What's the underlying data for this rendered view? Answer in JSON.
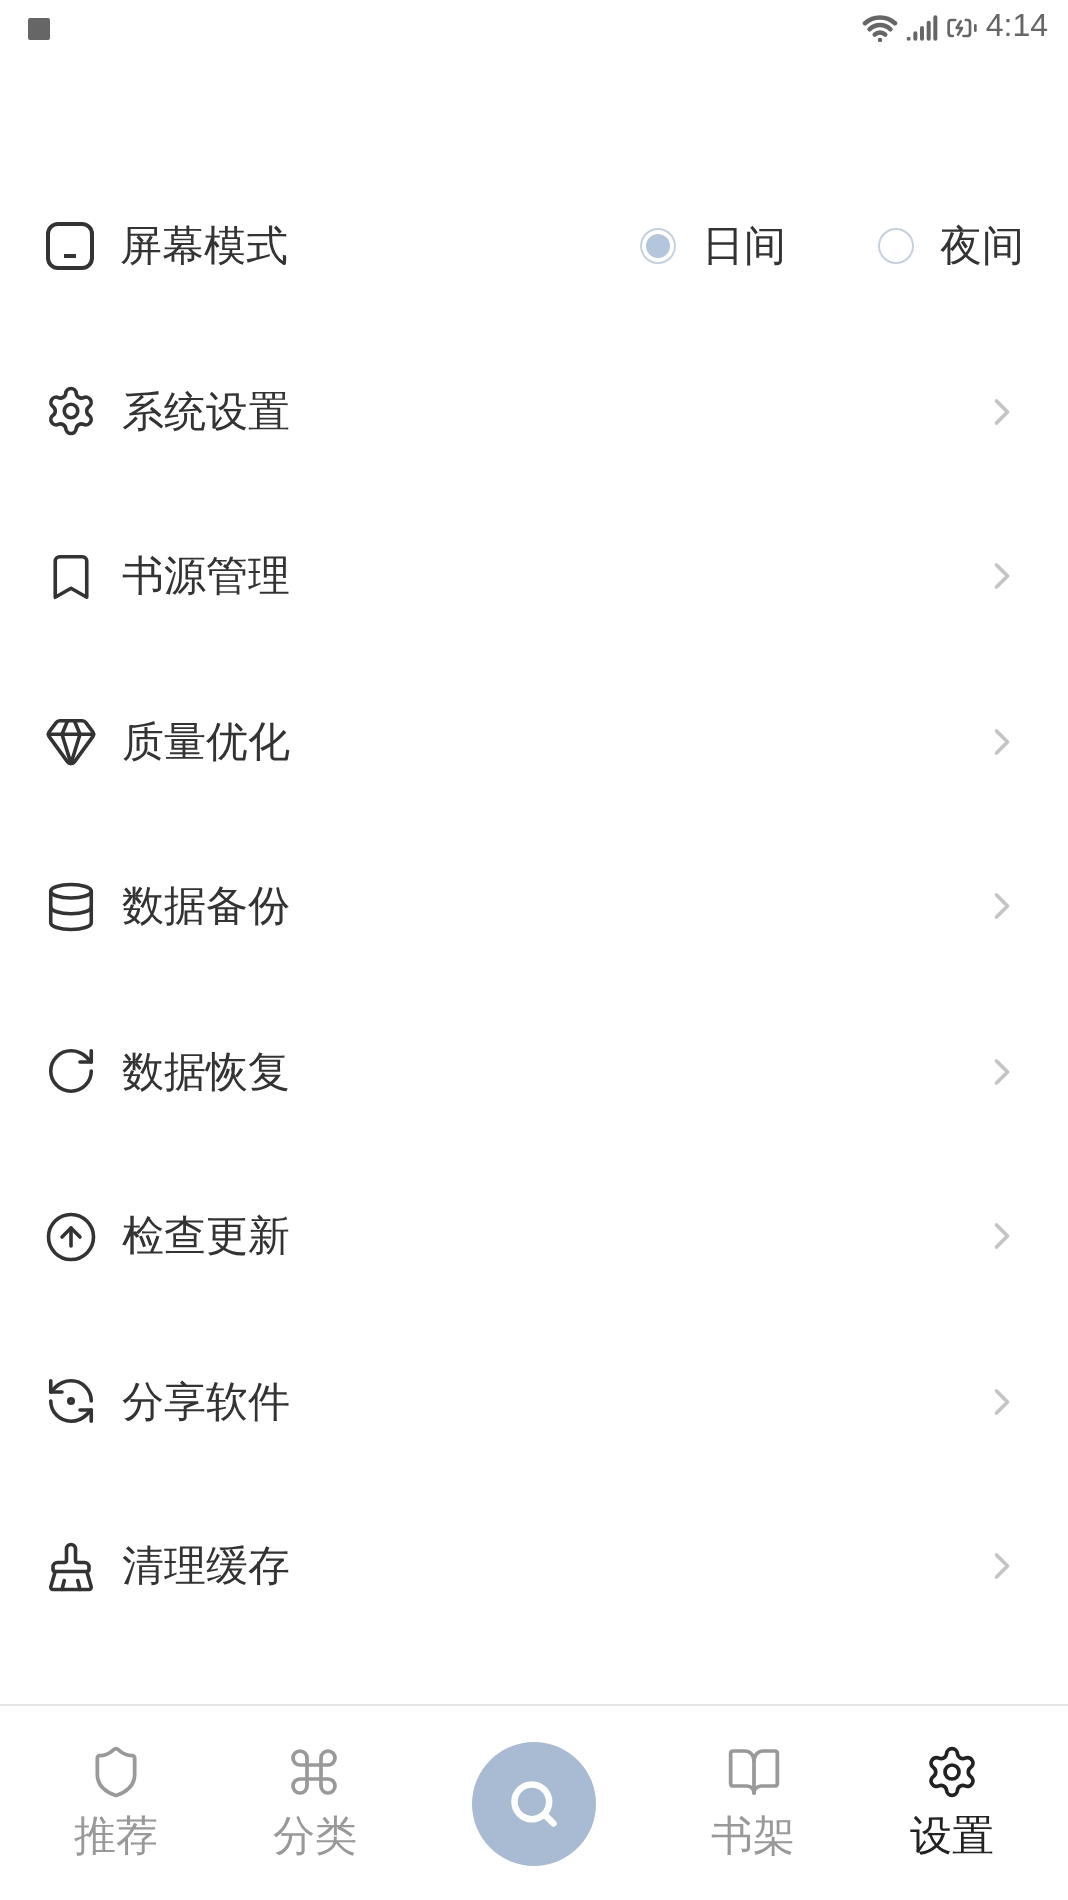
{
  "status_bar": {
    "time": "4:14"
  },
  "rows": [
    {
      "kind": "mode",
      "label": "屏幕模式",
      "options": [
        {
          "label": "日间",
          "selected": true
        },
        {
          "label": "夜间",
          "selected": false
        }
      ]
    },
    {
      "kind": "link",
      "label": "系统设置"
    },
    {
      "kind": "link",
      "label": "书源管理"
    },
    {
      "kind": "link",
      "label": "质量优化"
    },
    {
      "kind": "link",
      "label": "数据备份"
    },
    {
      "kind": "link",
      "label": "数据恢复"
    },
    {
      "kind": "link",
      "label": "检查更新"
    },
    {
      "kind": "link",
      "label": "分享软件"
    },
    {
      "kind": "link",
      "label": "清理缓存"
    }
  ],
  "nav": [
    {
      "kind": "tab",
      "label": "推荐",
      "selected": false
    },
    {
      "kind": "tab",
      "label": "分类",
      "selected": false
    },
    {
      "kind": "search"
    },
    {
      "kind": "tab",
      "label": "书架",
      "selected": false
    },
    {
      "kind": "tab",
      "label": "设置",
      "selected": true
    }
  ]
}
